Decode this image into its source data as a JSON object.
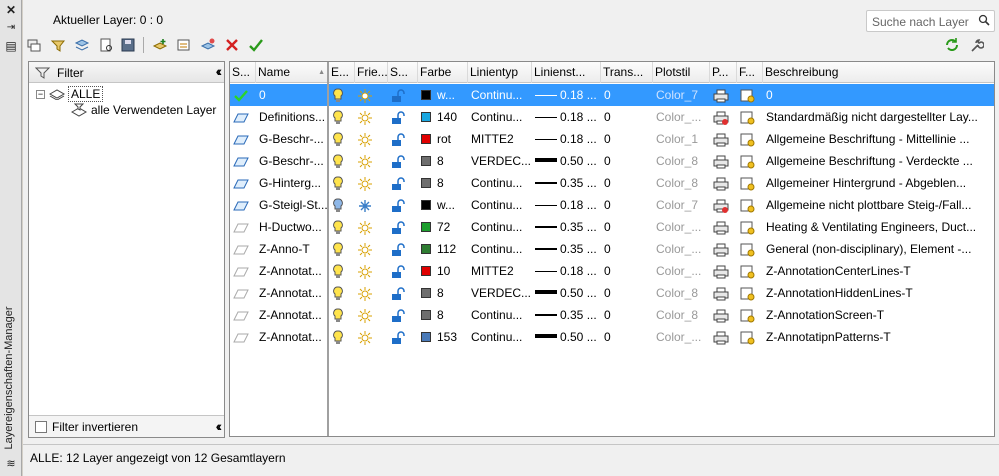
{
  "window": {
    "title": "Layereigenschaften-Manager"
  },
  "header": {
    "current_layer": "Aktueller Layer: 0 : 0",
    "search_placeholder": "Suche nach Layer"
  },
  "filter_panel": {
    "title": "Filter",
    "tree": [
      {
        "label": "ALLE"
      },
      {
        "label": "alle Verwendeten Layer"
      }
    ],
    "invert_label": "Filter invertieren"
  },
  "columns": [
    "S...",
    "Name",
    "E...",
    "Frie...",
    "S...",
    "Farbe",
    "Linientyp",
    "Linienst...",
    "Trans...",
    "Plotstil",
    "P...",
    "F...",
    "Beschreibung"
  ],
  "layers": [
    {
      "status": "current",
      "name": "0",
      "on": true,
      "frozen": false,
      "color": "#000000",
      "color_name": "w...",
      "linetype": "Continu...",
      "lw": "0.18 ...",
      "lwt": 1,
      "trans": "0",
      "plotstyle": "Color_7",
      "plot": "print",
      "desc": "0",
      "selected": true
    },
    {
      "status": "layer",
      "name": "Definitions...",
      "on": true,
      "frozen": false,
      "color": "#1aa7e0",
      "color_name": "140",
      "linetype": "Continu...",
      "lw": "0.18 ...",
      "lwt": 1,
      "trans": "0",
      "plotstyle": "Color_...",
      "plot": "noprint",
      "desc": "Standardmäßig nicht dargestellter Lay...",
      "selected": false
    },
    {
      "status": "layer",
      "name": "G-Beschr-...",
      "on": true,
      "frozen": false,
      "color": "#e00000",
      "color_name": "rot",
      "linetype": "MITTE2",
      "lw": "0.18 ...",
      "lwt": 1,
      "trans": "0",
      "plotstyle": "Color_1",
      "plot": "print",
      "desc": "Allgemeine Beschriftung - Mittellinie ...",
      "selected": false
    },
    {
      "status": "layer",
      "name": "G-Beschr-...",
      "on": true,
      "frozen": false,
      "color": "#6e6e6e",
      "color_name": "8",
      "linetype": "VERDEC...",
      "lw": "0.50 ...",
      "lwt": 4,
      "trans": "0",
      "plotstyle": "Color_8",
      "plot": "print",
      "desc": "Allgemeine Beschriftung - Verdeckte ...",
      "selected": false
    },
    {
      "status": "layer",
      "name": "G-Hinterg...",
      "on": true,
      "frozen": false,
      "color": "#6e6e6e",
      "color_name": "8",
      "linetype": "Continu...",
      "lw": "0.35 ...",
      "lwt": 2,
      "trans": "0",
      "plotstyle": "Color_8",
      "plot": "print",
      "desc": "Allgemeiner Hintergrund - Abgeblen...",
      "selected": false
    },
    {
      "status": "layer",
      "name": "G-Steigl-St...",
      "on": false,
      "frozen": true,
      "color": "#000000",
      "color_name": "w...",
      "linetype": "Continu...",
      "lw": "0.18 ...",
      "lwt": 1,
      "trans": "0",
      "plotstyle": "Color_7",
      "plot": "noprint",
      "desc": "Allgemeine nicht plottbare Steig-/Fall...",
      "selected": false
    },
    {
      "status": "unused",
      "name": "H-Ductwo...",
      "on": true,
      "frozen": false,
      "color": "#1d9e2e",
      "color_name": "72",
      "linetype": "Continu...",
      "lw": "0.35 ...",
      "lwt": 2,
      "trans": "0",
      "plotstyle": "Color_...",
      "plot": "print",
      "desc": "Heating & Ventilating Engineers, Duct...",
      "selected": false
    },
    {
      "status": "unused",
      "name": "Z-Anno-T",
      "on": true,
      "frozen": false,
      "color": "#2e7d32",
      "color_name": "112",
      "linetype": "Continu...",
      "lw": "0.35 ...",
      "lwt": 2,
      "trans": "0",
      "plotstyle": "Color_...",
      "plot": "print",
      "desc": "General (non-disciplinary), Element -...",
      "selected": false
    },
    {
      "status": "unused",
      "name": "Z-Annotat...",
      "on": true,
      "frozen": false,
      "color": "#e00000",
      "color_name": "10",
      "linetype": "MITTE2",
      "lw": "0.18 ...",
      "lwt": 1,
      "trans": "0",
      "plotstyle": "Color_...",
      "plot": "print",
      "desc": "Z-AnnotationCenterLines-T",
      "selected": false
    },
    {
      "status": "unused",
      "name": "Z-Annotat...",
      "on": true,
      "frozen": false,
      "color": "#6e6e6e",
      "color_name": "8",
      "linetype": "VERDEC...",
      "lw": "0.50 ...",
      "lwt": 4,
      "trans": "0",
      "plotstyle": "Color_8",
      "plot": "print",
      "desc": "Z-AnnotationHiddenLines-T",
      "selected": false
    },
    {
      "status": "unused",
      "name": "Z-Annotat...",
      "on": true,
      "frozen": false,
      "color": "#6e6e6e",
      "color_name": "8",
      "linetype": "Continu...",
      "lw": "0.35 ...",
      "lwt": 2,
      "trans": "0",
      "plotstyle": "Color_8",
      "plot": "print",
      "desc": "Z-AnnotationScreen-T",
      "selected": false
    },
    {
      "status": "unused",
      "name": "Z-Annotat...",
      "on": true,
      "frozen": false,
      "color": "#4a7ab8",
      "color_name": "153",
      "linetype": "Continu...",
      "lw": "0.50 ...",
      "lwt": 4,
      "trans": "0",
      "plotstyle": "Color_...",
      "plot": "print",
      "desc": "Z-AnnotatipnPatterns-T",
      "selected": false
    }
  ],
  "statusbar": {
    "text": "ALLE: 12 Layer angezeigt von 12 Gesamtlayern"
  }
}
